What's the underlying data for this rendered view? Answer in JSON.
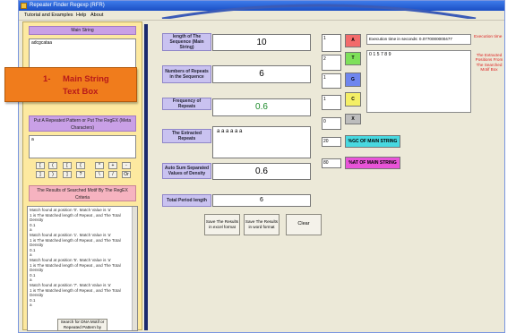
{
  "window": {
    "title": "Repeater Finder Regexp (RFR)"
  },
  "menu": [
    "Tutorial and Examples",
    "Help",
    "About"
  ],
  "left": {
    "main_string_header": "Main String",
    "main_string_value": "adcgcataa",
    "callout": {
      "number": "1-",
      "line1": "Main String",
      "line2": "Text Box"
    },
    "pattern_header": "Put A Repeated Pattern or Put The RegEX (Meta Characters)",
    "pattern_value": "a",
    "keypad_row1": [
      "[",
      "(",
      "[",
      "{",
      "*",
      "+",
      "-"
    ],
    "keypad_row2": [
      "]",
      ")",
      "]",
      "?",
      "\\",
      "/",
      "Or"
    ],
    "results_header": "The Results of Searched Motif By The RegEX Criteria",
    "results_lines": [
      "Match found at position '0'. Match Value is 'a'",
      "1 is The Matched length of Repeat , and The Total Density",
      "0.1",
      "a",
      "Match found at position '1'. Match Value is 'a'",
      "1 is The Matched length of Repeat , and The Total Density",
      "0.1",
      "a",
      "Match found at position '5'. Match Value is 'a'",
      "1 is The Matched length of Repeat , and The Total Density",
      "0.1",
      "a",
      "Match found at position '7'. Match Value is 'a'",
      "1 is The Matched length of Repeat , and The Total Density",
      "0.1",
      "a"
    ],
    "search_button": "Search for DNA Motif or Repeated Pattern by"
  },
  "fields": {
    "length_label": "length of The Sequence (Main String)",
    "length_value": "10",
    "repeats_label": "Numbers of Repeats in the Sequence",
    "repeats_value": "6",
    "frequency_label": "Frequency of Repeats",
    "frequency_value": "0.6",
    "extracted_label": "The Extracted Repeats",
    "extracted_value": "a a a a a a",
    "density_label": "Auto Sum Separated Values of Density",
    "density_value": "0.6",
    "period_label": "Total Period length",
    "period_value": "6"
  },
  "buttons": {
    "save_excel": "Save The Results in excel format",
    "save_word": "Save The Results in word format",
    "clear": "Clear"
  },
  "nucleotides": [
    {
      "count": "1",
      "label": "A",
      "color": "#f26b6b"
    },
    {
      "count": "2",
      "label": "T",
      "color": "#7ee05a"
    },
    {
      "count": "1",
      "label": "G",
      "color": "#6f86ee"
    },
    {
      "count": "1",
      "label": "C",
      "color": "#f4ef66"
    },
    {
      "count": "0",
      "label": "X",
      "color": "#bdbdbd"
    }
  ],
  "gc": {
    "count": "20",
    "label": "%GC OF MAIN STRING",
    "color": "#48d8e0"
  },
  "at": {
    "count": "80",
    "label": "%AT OF MAIN STRING",
    "color": "#e854d8"
  },
  "execution": {
    "text": "Execution time in seconds: 0.0770000000477",
    "label": "Execution time",
    "positions": "0 1 5 7 8 9",
    "positions_label": "The Extracted Positions From The Searched Motif Box"
  }
}
